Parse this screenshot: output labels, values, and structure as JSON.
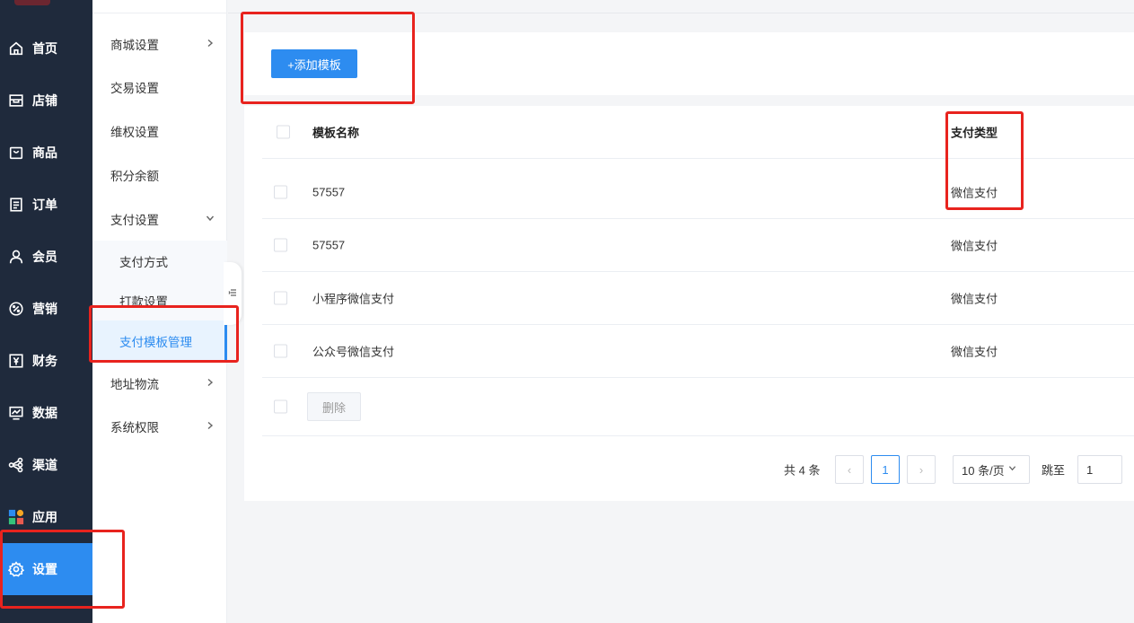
{
  "nav": {
    "items": [
      {
        "label": "首页",
        "icon": "home-icon"
      },
      {
        "label": "店铺",
        "icon": "shop-icon"
      },
      {
        "label": "商品",
        "icon": "bag-icon"
      },
      {
        "label": "订单",
        "icon": "order-icon"
      },
      {
        "label": "会员",
        "icon": "user-icon"
      },
      {
        "label": "营销",
        "icon": "discount-icon"
      },
      {
        "label": "财务",
        "icon": "yen-icon"
      },
      {
        "label": "数据",
        "icon": "chart-icon"
      },
      {
        "label": "渠道",
        "icon": "share-icon"
      },
      {
        "label": "应用",
        "icon": "apps-icon"
      },
      {
        "label": "设置",
        "icon": "gear-icon"
      }
    ],
    "active": "设置"
  },
  "submenu": {
    "items": [
      {
        "label": "商城设置",
        "chevron": "right"
      },
      {
        "label": "交易设置"
      },
      {
        "label": "维权设置"
      },
      {
        "label": "积分余额"
      },
      {
        "label": "支付设置",
        "chevron": "down"
      },
      {
        "label": "支付方式",
        "child": true
      },
      {
        "label": "打款设置",
        "child": true
      },
      {
        "label": "支付模板管理",
        "child": true,
        "selected": true
      },
      {
        "label": "地址物流",
        "chevron": "right"
      },
      {
        "label": "系统权限",
        "chevron": "right"
      }
    ]
  },
  "toolbar": {
    "add_label": "+添加模板"
  },
  "table": {
    "columns": {
      "name": "模板名称",
      "type": "支付类型"
    },
    "rows": [
      {
        "name": "57557",
        "type": "微信支付"
      },
      {
        "name": "57557",
        "type": "微信支付"
      },
      {
        "name": "小程序微信支付",
        "type": "微信支付"
      },
      {
        "name": "公众号微信支付",
        "type": "微信支付"
      }
    ],
    "delete_label": "删除"
  },
  "pagination": {
    "total": "共 4 条",
    "prev": "‹",
    "current": "1",
    "next": "›",
    "page_size": "10 条/页",
    "goto_label": "跳至",
    "goto_value": "1"
  },
  "colors": {
    "accent": "#2d8cf0",
    "nav_bg": "#1f2a3c",
    "annotation": "#e8231e"
  }
}
